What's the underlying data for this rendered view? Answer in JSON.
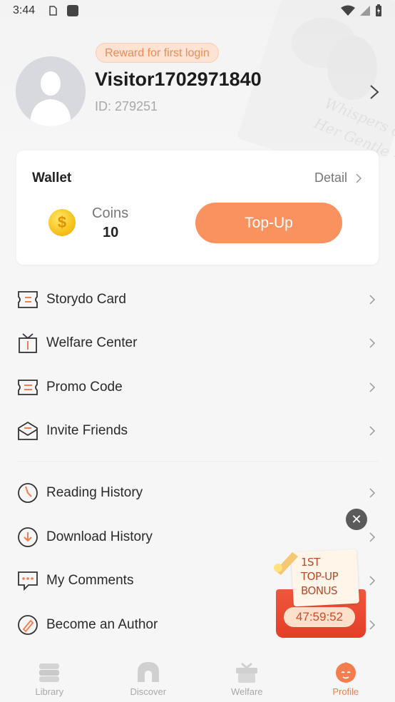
{
  "status_bar": {
    "time": "3:44"
  },
  "profile": {
    "reward_badge": "Reward for first login",
    "username": "Visitor1702971840",
    "user_id": "ID: 279251"
  },
  "wallet": {
    "title": "Wallet",
    "detail_label": "Detail",
    "coins_label": "Coins",
    "coins_value": "10",
    "topup_label": "Top-Up"
  },
  "menu": {
    "group1": [
      {
        "label": "Storydo Card",
        "icon": "card-icon"
      },
      {
        "label": "Welfare Center",
        "icon": "gift-box-icon"
      },
      {
        "label": "Promo Code",
        "icon": "ticket-icon"
      },
      {
        "label": "Invite Friends",
        "icon": "envelope-icon"
      }
    ],
    "group2": [
      {
        "label": "Reading History",
        "icon": "clock-icon"
      },
      {
        "label": "Download History",
        "icon": "download-icon"
      },
      {
        "label": "My Comments",
        "icon": "comment-icon"
      },
      {
        "label": "Become an Author",
        "icon": "pen-icon"
      }
    ]
  },
  "promo": {
    "line1": "1ST",
    "line2": "TOP-UP",
    "line3": "BONUS",
    "timer": "47:59:52"
  },
  "bottom_nav": [
    {
      "label": "Library",
      "icon": "library-icon",
      "active": false
    },
    {
      "label": "Discover",
      "icon": "discover-icon",
      "active": false
    },
    {
      "label": "Welfare",
      "icon": "welfare-icon",
      "active": false
    },
    {
      "label": "Profile",
      "icon": "profile-icon",
      "active": true
    }
  ],
  "colors": {
    "accent": "#f9925f",
    "active_nav": "#f57c4d",
    "badge_bg": "#fde3d3",
    "badge_text": "#ef8a56"
  }
}
